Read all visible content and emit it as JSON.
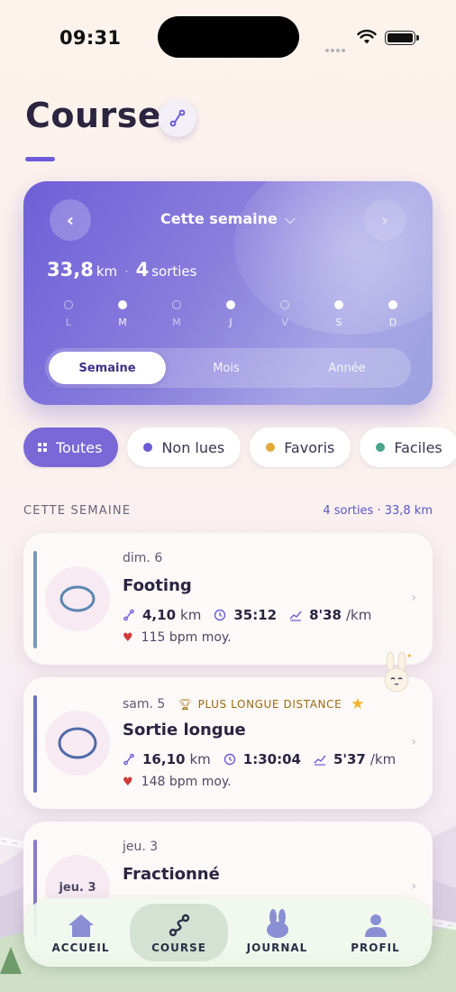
{
  "status_bar": {
    "time": "09:31"
  },
  "header": {
    "title": "Course"
  },
  "week_card": {
    "period": "Cette semaine",
    "prev": "‹",
    "next": "›",
    "distance": "33,8",
    "distance_unit": "km",
    "separator": "·",
    "runs": "4",
    "runs_unit": "sorties",
    "days": [
      {
        "label": "L",
        "active": false
      },
      {
        "label": "M",
        "active": true
      },
      {
        "label": "M",
        "active": false
      },
      {
        "label": "J",
        "active": true
      },
      {
        "label": "V",
        "active": false
      },
      {
        "label": "S",
        "active": true
      },
      {
        "label": "D",
        "active": true
      }
    ],
    "segments": [
      "Semaine",
      "Mois",
      "Année"
    ],
    "selected_segment": "Semaine"
  },
  "filters": [
    {
      "label": "Toutes",
      "active": true
    },
    {
      "label": "Non lues",
      "dot_color": "#6b5bd6"
    },
    {
      "label": "Favoris",
      "dot_color": "#e0a93a"
    },
    {
      "label": "Faciles",
      "dot_color": "#4aa58a"
    }
  ],
  "section": {
    "label": "CETTE SEMAINE",
    "meta": "4 sorties · 33,8 km"
  },
  "runs": [
    {
      "date": "dim. 6",
      "name": "Footing",
      "distance": "4,10",
      "distance_unit": "km",
      "duration": "35:12",
      "pace": "8'38",
      "pace_unit": "/km",
      "heart_rate": "115 bpm moy.",
      "bar_color": "#7a9ab8"
    },
    {
      "date": "sam. 5",
      "badge": "PLUS LONGUE DISTANCE",
      "name": "Sortie longue",
      "distance": "16,10",
      "distance_unit": "km",
      "duration": "1:30:04",
      "pace": "5'37",
      "pace_unit": "/km",
      "heart_rate": "148 bpm moy.",
      "bar_color": "#6a74b8"
    },
    {
      "date": "jeu. 3",
      "name": "Fractionné",
      "thumb_label": "jeu. 3",
      "bar_color": "#8a7ac4"
    }
  ],
  "tabbar": [
    {
      "label": "ACCUEIL",
      "icon": "home-icon"
    },
    {
      "label": "COURSE",
      "icon": "route-icon",
      "active": true
    },
    {
      "label": "JOURNAL",
      "icon": "bunny-icon"
    },
    {
      "label": "PROFIL",
      "icon": "person-icon"
    }
  ],
  "colors": {
    "accent": "#6b5bd6",
    "heart": "#d13a3a",
    "star": "#f0b428"
  }
}
